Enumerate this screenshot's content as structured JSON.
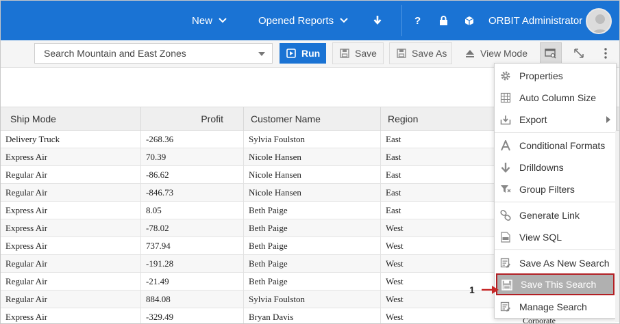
{
  "topbar": {
    "new_label": "New",
    "opened_reports_label": "Opened Reports",
    "user_name": "ORBIT Administrator",
    "help_glyph": "?"
  },
  "toolbar": {
    "search_value": "Search Mountain and East Zones",
    "run_label": "Run",
    "save_label": "Save",
    "save_as_label": "Save As",
    "view_mode_label": "View Mode"
  },
  "table": {
    "columns": [
      "Ship Mode",
      "Profit",
      "Customer Name",
      "Region"
    ],
    "rows": [
      [
        "Delivery Truck",
        "-268.36",
        "Sylvia Foulston",
        "East"
      ],
      [
        "Express Air",
        "70.39",
        "Nicole Hansen",
        "East"
      ],
      [
        "Regular Air",
        "-86.62",
        "Nicole Hansen",
        "East"
      ],
      [
        "Regular Air",
        "-846.73",
        "Nicole Hansen",
        "East"
      ],
      [
        "Express Air",
        "8.05",
        "Beth Paige",
        "East"
      ],
      [
        "Express Air",
        "-78.02",
        "Beth Paige",
        "West"
      ],
      [
        "Express Air",
        "737.94",
        "Beth Paige",
        "West"
      ],
      [
        "Regular Air",
        "-191.28",
        "Beth Paige",
        "West"
      ],
      [
        "Regular Air",
        "-21.49",
        "Beth Paige",
        "West"
      ],
      [
        "Regular Air",
        "884.08",
        "Sylvia Foulston",
        "West"
      ],
      [
        "Express Air",
        "-329.49",
        "Bryan Davis",
        "West"
      ]
    ],
    "partial_cell_text": "Corporate"
  },
  "menu": {
    "items": [
      {
        "label": "Properties",
        "icon": "gear-icon"
      },
      {
        "label": "Auto Column Size",
        "icon": "grid-icon"
      },
      {
        "label": "Export",
        "icon": "export-icon"
      },
      {
        "label": "Conditional Formats",
        "icon": "format-icon"
      },
      {
        "label": "Drilldowns",
        "icon": "arrow-down-icon"
      },
      {
        "label": "Group Filters",
        "icon": "filter-icon"
      },
      {
        "label": "Generate Link",
        "icon": "link-icon"
      },
      {
        "label": "View SQL",
        "icon": "sql-icon"
      },
      {
        "label": "Save As New Search",
        "icon": "save-as-new-icon"
      },
      {
        "label": "Save This Search",
        "icon": "save-icon"
      },
      {
        "label": "Manage Search",
        "icon": "manage-search-icon"
      }
    ],
    "highlighted_index": 9
  },
  "callout": {
    "number": "1"
  },
  "colors": {
    "brand_blue": "#1a73d4",
    "highlight_border": "#b21f24",
    "callout_arrow": "#c62828"
  }
}
